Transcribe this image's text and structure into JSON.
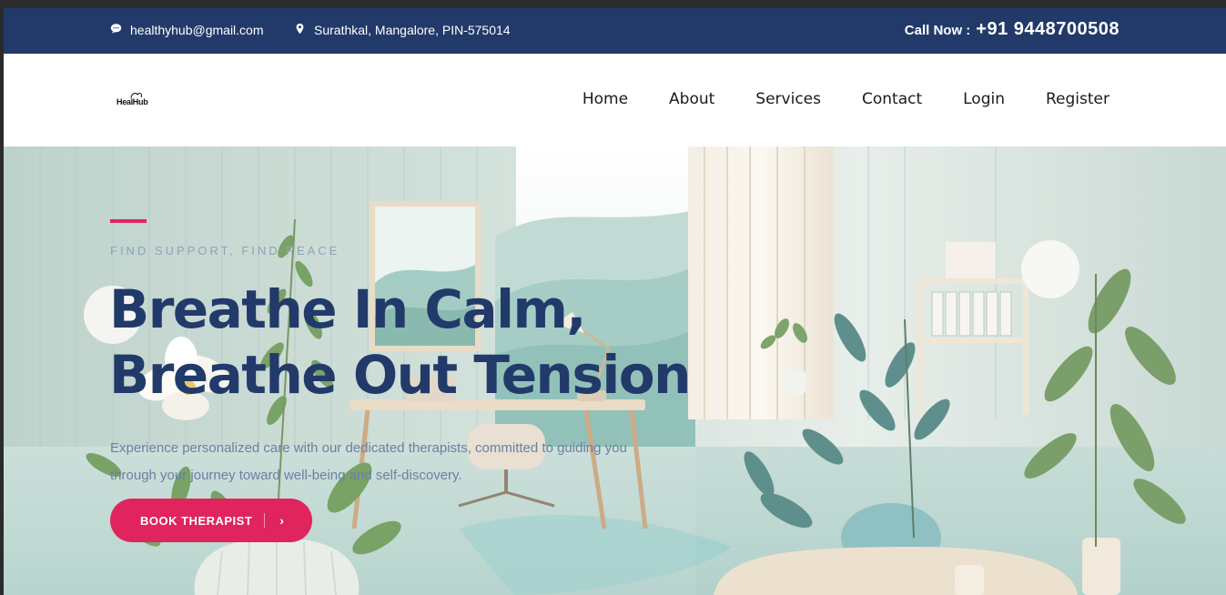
{
  "topbar": {
    "email": "healthyhub@gmail.com",
    "address": "Surathkal, Mangalore, PIN-575014",
    "call_label": "Call Now :",
    "phone": "+91 9448700508",
    "background": "#223a6a"
  },
  "logo": {
    "text": "HealHub"
  },
  "nav": {
    "items": [
      {
        "label": "Home"
      },
      {
        "label": "About"
      },
      {
        "label": "Services"
      },
      {
        "label": "Contact"
      },
      {
        "label": "Login"
      },
      {
        "label": "Register"
      }
    ]
  },
  "hero": {
    "eyebrow": "FIND SUPPORT, FIND PEACE",
    "headline_line1": "Breathe In Calm,",
    "headline_line2": "Breathe Out Tension",
    "description": "Experience personalized care with our dedicated therapists, committed to guiding you through your journey toward well-being and self-discovery.",
    "cta_label": "BOOK THERAPIST",
    "cta_icon": "chevron-right-icon",
    "accent_color": "#e0245e",
    "headline_color": "#223a6a"
  }
}
